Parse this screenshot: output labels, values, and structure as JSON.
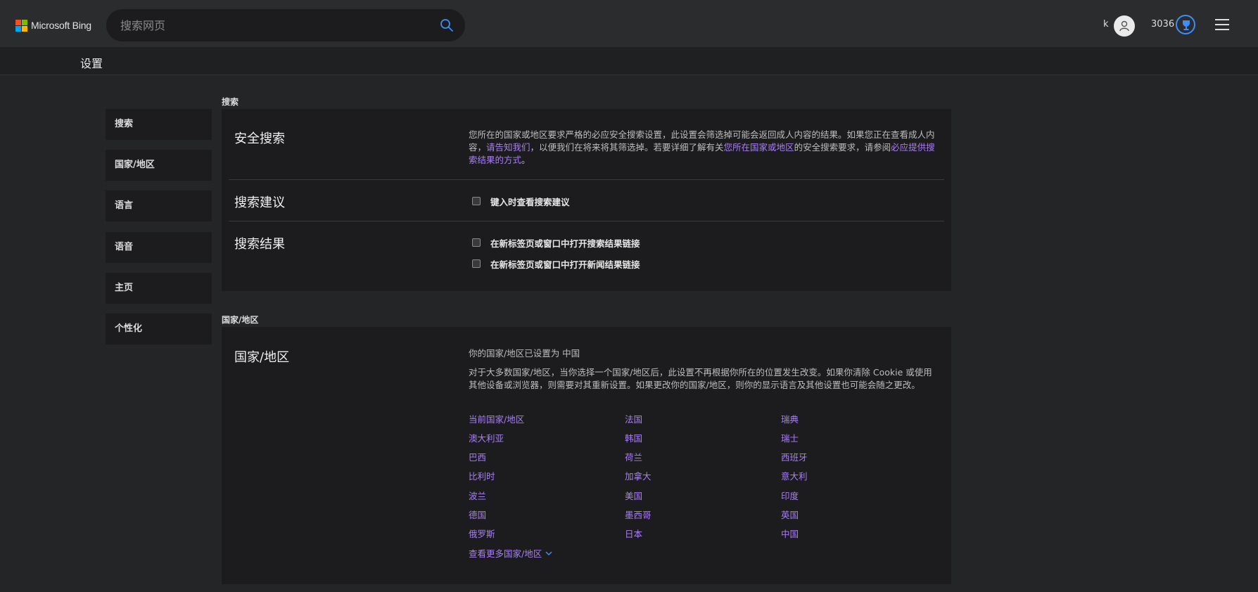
{
  "header": {
    "logo_text": "Microsoft Bing",
    "search_placeholder": "搜索网页",
    "user_name": "k",
    "points": "3036"
  },
  "settings_bar": {
    "title": "设置"
  },
  "nav": [
    {
      "label": "搜索"
    },
    {
      "label": "国家/地区"
    },
    {
      "label": "语言"
    },
    {
      "label": "语音"
    },
    {
      "label": "主页"
    },
    {
      "label": "个性化"
    }
  ],
  "search_section": {
    "label": "搜索",
    "safe_search": {
      "title": "安全搜索",
      "text1": "您所在的国家或地区要求严格的必应安全搜索设置，此设置会筛选掉可能会返回成人内容的结果。如果您正在查看成人内容，",
      "link1": "请告知我们",
      "text2": "，以便我们在将来将其筛选掉。若要详细了解有关",
      "link2": "您所在国家或地区",
      "text3": "的安全搜索要求，请参阅",
      "link3": "必应提供搜索结果的方式",
      "text4": "。"
    },
    "suggestions": {
      "title": "搜索建议",
      "checkbox_label": "键入时查看搜索建议"
    },
    "results": {
      "title": "搜索结果",
      "checkbox1_label": "在新标签页或窗口中打开搜索结果链接",
      "checkbox2_label": "在新标签页或窗口中打开新闻结果链接"
    }
  },
  "region_section": {
    "label": "国家/地区",
    "title": "国家/地区",
    "current": "你的国家/地区已设置为 中国",
    "description": "对于大多数国家/地区，当你选择一个国家/地区后，此设置不再根据你所在的位置发生改变。如果你清除 Cookie 或使用其他设备或浏览器，则需要对其重新设置。如果更改你的国家/地区，则你的显示语言及其他设置也可能会随之更改。",
    "countries_col1": [
      "当前国家/地区",
      "澳大利亚",
      "巴西",
      "比利时",
      "波兰",
      "德国",
      "俄罗斯"
    ],
    "countries_col2": [
      "法国",
      "韩国",
      "荷兰",
      "加拿大",
      "美国",
      "墨西哥",
      "日本"
    ],
    "countries_col3": [
      "瑞典",
      "瑞士",
      "西班牙",
      "意大利",
      "印度",
      "英国",
      "中国"
    ],
    "see_more": "查看更多国家/地区"
  },
  "colors": {
    "link": "#a87ff3",
    "accent_blue": "#3e8ef7",
    "panel": "#1c1c1e",
    "background": "#242527"
  }
}
